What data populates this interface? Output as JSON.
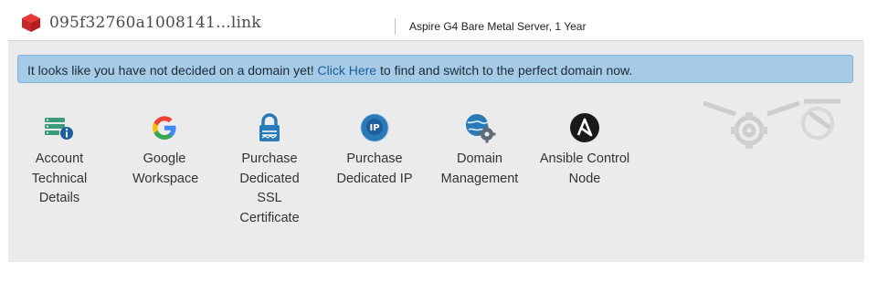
{
  "header": {
    "domain": "095f32760a1008141...link",
    "product": "Aspire G4 Bare Metal Server, 1 Year"
  },
  "alert": {
    "text_before": "It looks like you have not decided on a domain yet! ",
    "link_text": "Click Here",
    "text_after": " to find and switch to the perfect domain now."
  },
  "tiles": [
    {
      "label": "Account Technical Details",
      "icon": "account-details-icon"
    },
    {
      "label": "Google Workspace",
      "icon": "google-icon"
    },
    {
      "label": "Purchase Dedicated SSL Certificate",
      "icon": "ssl-lock-icon"
    },
    {
      "label": "Purchase Dedicated IP",
      "icon": "ip-icon"
    },
    {
      "label": "Domain Management",
      "icon": "domain-gear-icon"
    },
    {
      "label": "Ansible Control Node",
      "icon": "ansible-icon"
    }
  ],
  "colors": {
    "accent": "#2a7ab8",
    "alert_bg": "#a6cbe7",
    "panel_bg": "#ebebeb",
    "cube_red": "#d32f2f"
  }
}
